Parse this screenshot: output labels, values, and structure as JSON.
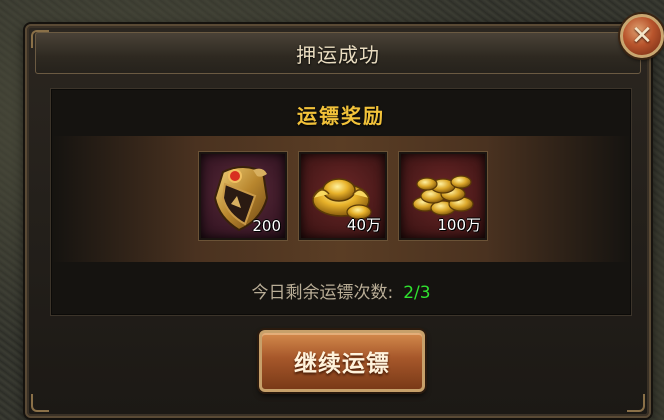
{
  "dialog": {
    "title": "押运成功",
    "close_icon": "close-x-icon"
  },
  "rewards": {
    "title": "运镖奖励",
    "items": [
      {
        "icon": "bronze-badge-icon",
        "quantity": "200"
      },
      {
        "icon": "gold-ingot-icon",
        "quantity": "40万"
      },
      {
        "icon": "gold-coins-icon",
        "quantity": "100万"
      }
    ]
  },
  "remaining": {
    "label": "今日剩余运镖次数:",
    "value": "2/3"
  },
  "actions": {
    "continue_label": "继续运镖"
  },
  "colors": {
    "title_gold": "#f2c23a",
    "count_green": "#2fe22f",
    "button_orange": "#a6572a"
  }
}
